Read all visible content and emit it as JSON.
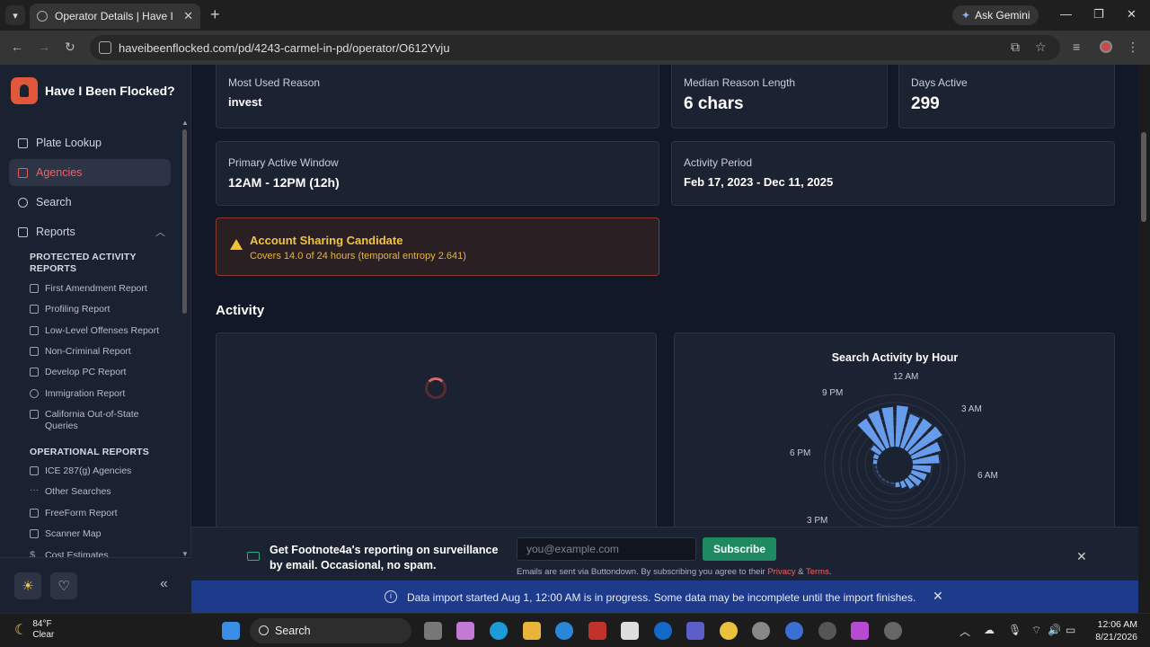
{
  "browser": {
    "tab_title": "Operator Details | Have I Been Flocked?",
    "ask_gemini": "Ask Gemini",
    "url": "haveibeenflocked.com/pd/4243-carmel-in-pd/operator/O612Yvju"
  },
  "sidebar": {
    "brand": "Have I Been Flocked?",
    "nav": [
      {
        "label": "Plate Lookup",
        "icon": "home-icon"
      },
      {
        "label": "Agencies",
        "icon": "building-icon",
        "active": true
      },
      {
        "label": "Search",
        "icon": "search-icon"
      },
      {
        "label": "Reports",
        "icon": "bar-chart-icon"
      }
    ],
    "protected_header": "PROTECTED ACTIVITY REPORTS",
    "protected_items": [
      "First Amendment Report",
      "Profiling Report",
      "Low-Level Offenses Report",
      "Non-Criminal Report",
      "Develop PC Report",
      "Immigration Report",
      "California Out-of-State Queries"
    ],
    "operational_header": "OPERATIONAL REPORTS",
    "operational_items": [
      "ICE 287(g) Agencies",
      "Other Searches",
      "FreeForm Report",
      "Scanner Map",
      "Cost Estimates"
    ]
  },
  "stats": {
    "most_used_reason_label": "Most Used Reason",
    "most_used_reason_value": "invest",
    "median_reason_length_label": "Median Reason Length",
    "median_reason_length_value": "6 chars",
    "days_active_label": "Days Active",
    "days_active_value": "299",
    "primary_window_label": "Primary Active Window",
    "primary_window_value": "12AM - 12PM (12h)",
    "activity_period_label": "Activity Period",
    "activity_period_value": "Feb 17, 2023 - Dec 11, 2025"
  },
  "alert": {
    "title": "Account Sharing Candidate",
    "detail": "Covers 14.0 of 24 hours (temporal entropy 2.641)",
    "color": "#f3c53a"
  },
  "activity": {
    "section_title": "Activity",
    "radial_title": "Search Activity by Hour",
    "hour_labels": [
      "12 AM",
      "3 AM",
      "6 AM",
      "3 PM",
      "6 PM",
      "9 PM"
    ]
  },
  "chart_data": {
    "type": "radial-bar",
    "title": "Search Activity by Hour",
    "categories": [
      "12 AM",
      "1 AM",
      "2 AM",
      "3 AM",
      "4 AM",
      "5 AM",
      "6 AM",
      "7 AM",
      "8 AM",
      "9 AM",
      "10 AM",
      "11 AM",
      "12 PM",
      "1 PM",
      "2 PM",
      "3 PM",
      "4 PM",
      "5 PM",
      "6 PM",
      "7 PM",
      "8 PM",
      "9 PM",
      "10 PM",
      "11 PM"
    ],
    "values": [
      0.85,
      0.72,
      0.75,
      0.78,
      0.62,
      0.55,
      0.38,
      0.32,
      0.28,
      0.22,
      0.14,
      0.1,
      0,
      0,
      0,
      0,
      0,
      0,
      0.08,
      0.1,
      0.22,
      0.75,
      0.8,
      0.82
    ],
    "value_scale": "relative (0-1)",
    "color": "#6aa3f5"
  },
  "newsletter": {
    "text": "Get Footnote4a's reporting on surveillance by email. Occasional, no spam.",
    "placeholder": "you@example.com",
    "button": "Subscribe",
    "small_prefix": "Emails are sent via Buttondown. By subscribing you agree to their",
    "privacy": "Privacy",
    "amp": "&",
    "terms": "Terms",
    "period": "."
  },
  "banner": {
    "text": "Data import started Aug 1, 12:00 AM is in progress. Some data may be incomplete until the import finishes."
  },
  "taskbar": {
    "temp": "84°F",
    "condition": "Clear",
    "search": "Search",
    "time": "12:06 AM",
    "date": "8/21/2026"
  }
}
